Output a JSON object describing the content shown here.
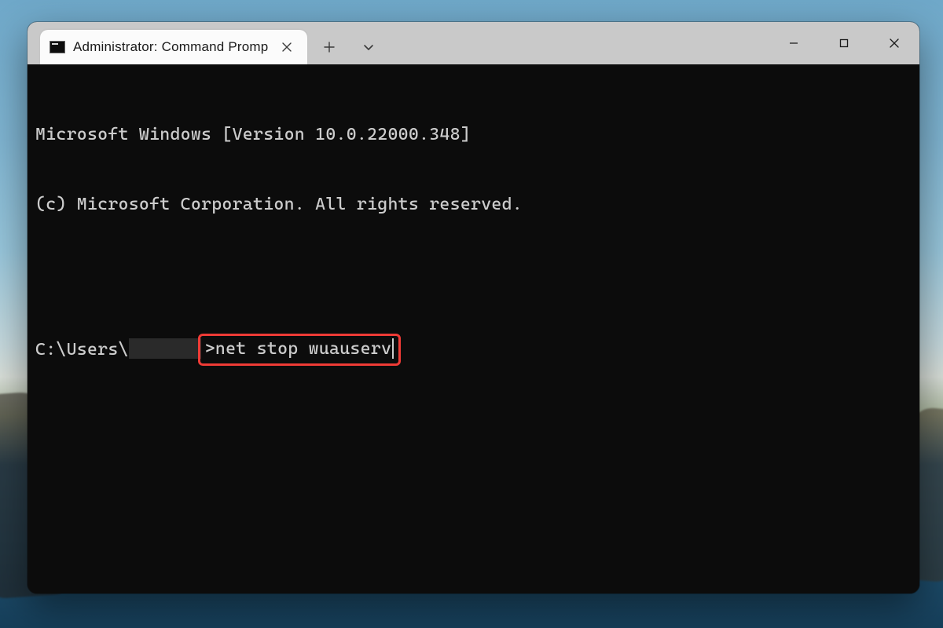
{
  "titlebar": {
    "tab_title": "Administrator: Command Promp",
    "tab_close_label": "Close tab",
    "new_tab_label": "New tab",
    "tab_dropdown_label": "Tab dropdown"
  },
  "window_controls": {
    "minimize": "Minimize",
    "maximize": "Maximize",
    "close": "Close"
  },
  "terminal": {
    "banner_line1": "Microsoft Windows [Version 10.0.22000.348]",
    "banner_line2": "(c) Microsoft Corporation. All rights reserved.",
    "prompt_prefix": "C:\\Users\\",
    "prompt_suffix": ">",
    "command": "net stop wuauserv"
  },
  "annotation": {
    "highlight_color": "#ef3b36"
  }
}
